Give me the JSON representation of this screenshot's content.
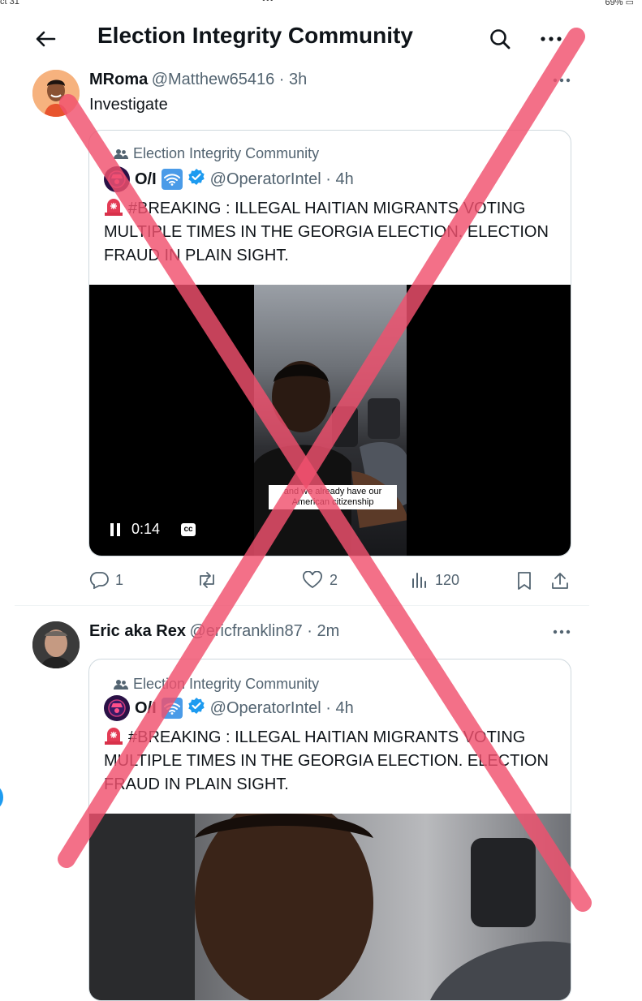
{
  "status_bar": {
    "time": "ct 31",
    "battery": "69%",
    "dots": "•••"
  },
  "header": {
    "title": "Election Integrity Community"
  },
  "icons": {
    "back": "back-arrow-icon",
    "search": "search-icon",
    "more": "more-icon"
  },
  "tweets": [
    {
      "name": "MRoma",
      "handle": "@Matthew65416 · 3h",
      "text": "Investigate",
      "quote": {
        "community": "Election Integrity Community",
        "name": "O/I",
        "handle": "@OperatorIntel · 4h",
        "text": "#BREAKING : ILLEGAL HAITIAN MIGRANTS VOTING MULTIPLE TIMES IN THE GEORGIA ELECTION. ELECTION FRAUD IN PLAIN SIGHT.",
        "video": {
          "caption": "and we already have our American citizenship",
          "time": "0:14",
          "cc": "cc"
        }
      },
      "actions": {
        "replies": "1",
        "reposts": "",
        "likes": "2",
        "views": "120"
      }
    },
    {
      "name": "Eric aka Rex",
      "handle": "@ericfranklin87 · 2m",
      "quote": {
        "community": "Election Integrity Community",
        "name": "O/I",
        "handle": "@OperatorIntel · 4h",
        "text": "#BREAKING : ILLEGAL HAITIAN MIGRANTS VOTING MULTIPLE TIMES IN THE GEORGIA ELECTION. ELECTION FRAUD IN PLAIN SIGHT."
      }
    }
  ],
  "colors": {
    "accent": "#1d9bf0",
    "overlay_x": "#f0506e",
    "verified": "#1d9bf0"
  }
}
